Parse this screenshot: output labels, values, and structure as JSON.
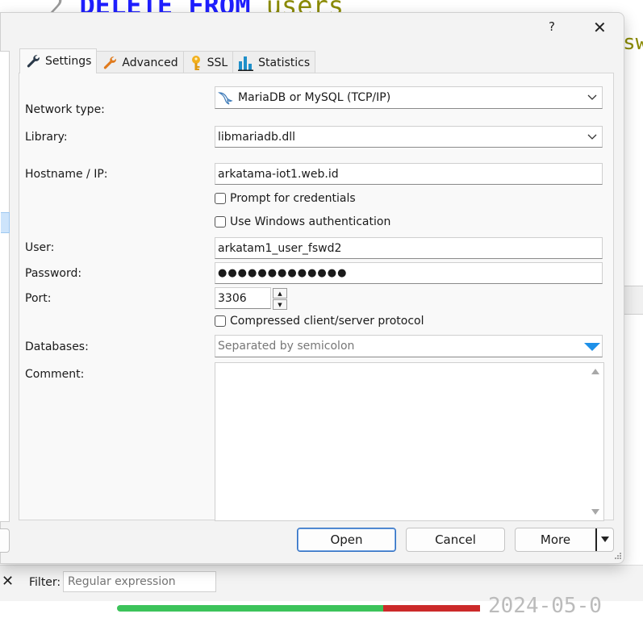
{
  "background": {
    "sql_line_number": "2",
    "sql_keywords": "DELETE FROM",
    "sql_identifier": "users",
    "sql_fragment_right": "sw",
    "filter_label": "Filter:",
    "filter_placeholder": "Regular expression",
    "bottom_text": "2024-05-0"
  },
  "titlebar": {
    "help_label": "?",
    "close_label": "✕"
  },
  "tabs": [
    {
      "label": "Settings",
      "icon": "wrench-icon",
      "active": true
    },
    {
      "label": "Advanced",
      "icon": "wrench-orange-icon",
      "active": false
    },
    {
      "label": "SSL",
      "icon": "key-icon",
      "active": false
    },
    {
      "label": "Statistics",
      "icon": "bar-chart-icon",
      "active": false
    }
  ],
  "form": {
    "network_type_label": "Network type:",
    "network_type_value": "MariaDB or MySQL (TCP/IP)",
    "library_label": "Library:",
    "library_value": "libmariadb.dll",
    "hostname_label": "Hostname / IP:",
    "hostname_value": "arkatama-iot1.web.id",
    "prompt_credentials_label": "Prompt for credentials",
    "windows_auth_label": "Use Windows authentication",
    "user_label": "User:",
    "user_value": "arkatam1_user_fswd2",
    "password_label": "Password:",
    "password_value": "●●●●●●●●●●●●●",
    "port_label": "Port:",
    "port_value": "3306",
    "compressed_label": "Compressed client/server protocol",
    "databases_label": "Databases:",
    "databases_placeholder": "Separated by semicolon",
    "comment_label": "Comment:"
  },
  "buttons": {
    "open": "Open",
    "cancel": "Cancel",
    "more": "More"
  },
  "colors": {
    "primary_border": "#2f6fc2",
    "db_arrow": "#1e90e8",
    "progress_green": "#3cc35a",
    "progress_red": "#cc2a2a"
  }
}
